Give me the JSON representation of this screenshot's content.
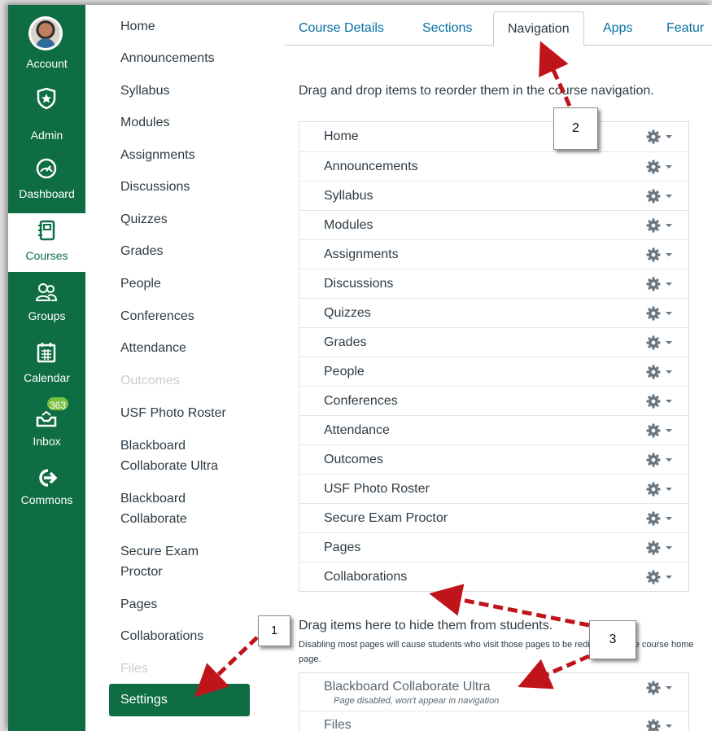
{
  "global_nav": {
    "items": [
      {
        "label": "Account",
        "icon": "avatar"
      },
      {
        "label": "Admin",
        "icon": "shield-star-icon"
      },
      {
        "label": "Dashboard",
        "icon": "gauge-icon"
      },
      {
        "label": "Courses",
        "icon": "notebook-icon"
      },
      {
        "label": "Groups",
        "icon": "people-icon"
      },
      {
        "label": "Calendar",
        "icon": "calendar-icon"
      },
      {
        "label": "Inbox",
        "icon": "inbox-icon",
        "badge": "363"
      },
      {
        "label": "Commons",
        "icon": "commons-arrow-icon"
      }
    ],
    "active": "Courses",
    "colors": {
      "background": "#0f6d43",
      "badge": "#7bc142"
    }
  },
  "course_nav": {
    "items": [
      {
        "label": "Home"
      },
      {
        "label": "Announcements"
      },
      {
        "label": "Syllabus"
      },
      {
        "label": "Modules"
      },
      {
        "label": "Assignments"
      },
      {
        "label": "Discussions"
      },
      {
        "label": "Quizzes"
      },
      {
        "label": "Grades"
      },
      {
        "label": "People"
      },
      {
        "label": "Conferences"
      },
      {
        "label": "Attendance"
      },
      {
        "label": "Outcomes",
        "disabled": true
      },
      {
        "label": "USF Photo Roster"
      },
      {
        "label": "Blackboard Collaborate Ultra"
      },
      {
        "label": "Blackboard Collaborate"
      },
      {
        "label": "Secure Exam Proctor"
      },
      {
        "label": "Pages"
      },
      {
        "label": "Collaborations"
      },
      {
        "label": "Files",
        "disabled": true
      },
      {
        "label": "Settings",
        "active": true
      }
    ]
  },
  "tabs": [
    {
      "label": "Course Details"
    },
    {
      "label": "Sections"
    },
    {
      "label": "Navigation",
      "active": true
    },
    {
      "label": "Apps"
    },
    {
      "label": "Featur"
    }
  ],
  "navigation": {
    "instructions": "Drag and drop items to reorder them in the course navigation.",
    "enabled_items": [
      "Home",
      "Announcements",
      "Syllabus",
      "Modules",
      "Assignments",
      "Discussions",
      "Quizzes",
      "Grades",
      "People",
      "Conferences",
      "Attendance",
      "Outcomes",
      "USF Photo Roster",
      "Secure Exam Proctor",
      "Pages",
      "Collaborations"
    ],
    "hide_title": "Drag items here to hide them from students.",
    "hide_note": "Disabling most pages will cause students who visit those pages to be redirected to the course home page.",
    "disabled_items": [
      {
        "name": "Blackboard Collaborate Ultra",
        "sub": "Page disabled, won't appear in navigation"
      },
      {
        "name": "Files",
        "sub": ""
      }
    ]
  },
  "callouts": [
    "1",
    "2",
    "3"
  ],
  "arrow_color": "#c0141b"
}
